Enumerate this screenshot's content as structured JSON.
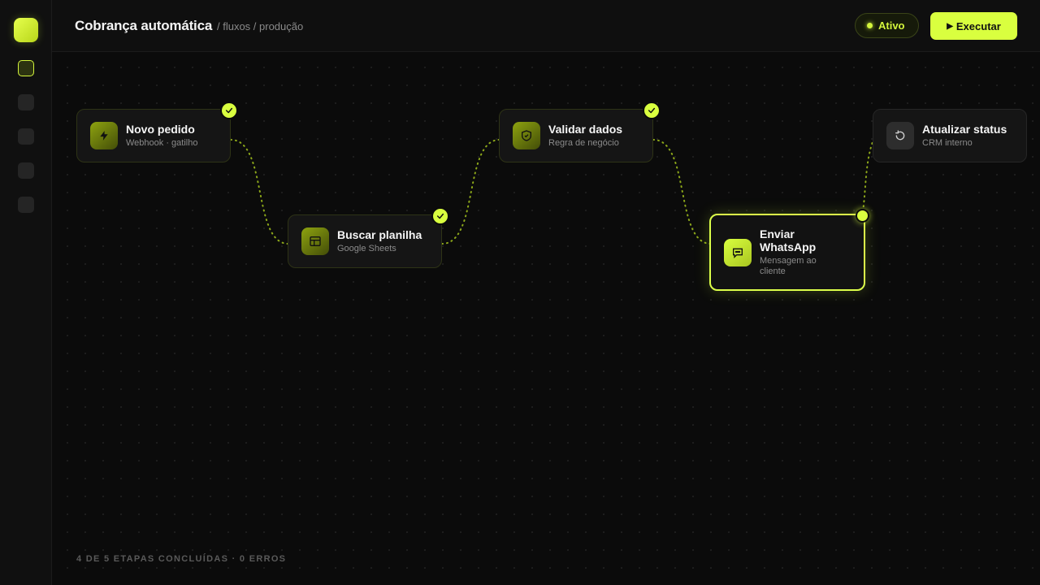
{
  "header": {
    "title": "Cobrança automática",
    "breadcrumb": "/ fluxos / produção",
    "status": "Ativo",
    "run_button": "Executar"
  },
  "sidebar": {
    "items": [
      {
        "icon": "flow-icon",
        "active": true
      },
      {
        "icon": "nav-icon",
        "active": false
      },
      {
        "icon": "nav-icon",
        "active": false
      },
      {
        "icon": "nav-icon",
        "active": false
      },
      {
        "icon": "nav-icon",
        "active": false
      }
    ]
  },
  "nodes": [
    {
      "title": "Novo pedido",
      "subtitle": "Webhook · gatilho",
      "icon": "bolt-icon",
      "state": "done"
    },
    {
      "title": "Buscar planilha",
      "subtitle": "Google Sheets",
      "icon": "table-icon",
      "state": "done"
    },
    {
      "title": "Validar dados",
      "subtitle": "Regra de negócio",
      "icon": "shield-check-icon",
      "state": "done"
    },
    {
      "title": "Enviar WhatsApp",
      "subtitle": "Mensagem ao cliente",
      "icon": "chat-icon",
      "state": "running"
    },
    {
      "title": "Atualizar status",
      "subtitle": "CRM interno",
      "icon": "refresh-icon",
      "state": "pending"
    }
  ],
  "footer": {
    "progress_text": "4 DE 5 ETAPAS CONCLUÍDAS · 0 ERROS"
  },
  "colors": {
    "accent": "#d9ff3f",
    "background": "#0b0b0b",
    "node_bg": "#151515"
  }
}
